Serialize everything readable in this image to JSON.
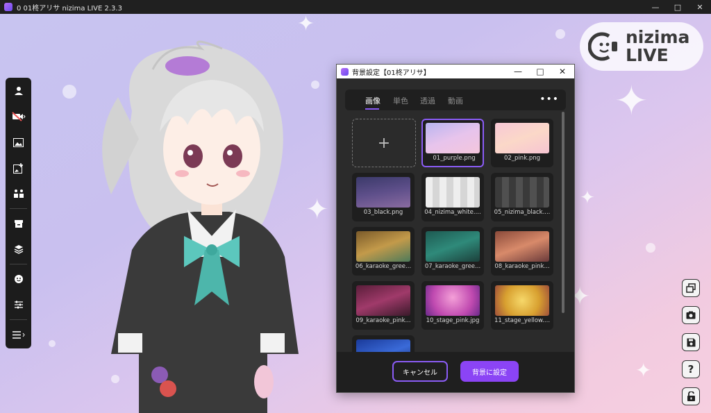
{
  "app": {
    "title": "0 01柊アリサ nizima LIVE 2.3.3"
  },
  "logo": {
    "line1": "nizima",
    "line2": "LIVE"
  },
  "left_toolbar": {
    "items": [
      "person-icon",
      "video-off-icon",
      "image-icon",
      "add-image-icon",
      "two-person-icon",
      "box-icon",
      "layers-icon",
      "smile-icon",
      "sliders-icon",
      "menu-icon"
    ]
  },
  "right_toolbar": {
    "items": [
      "windows-icon",
      "camera-icon",
      "save-icon",
      "help-icon",
      "unlock-icon"
    ]
  },
  "dialog": {
    "title": "背景設定【01柊アリサ】",
    "tabs": [
      "画像",
      "単色",
      "透過",
      "動画"
    ],
    "active_tab": "画像",
    "more": "•••",
    "add_symbol": "+",
    "files": [
      {
        "name": "01_purple.png",
        "selected": true
      },
      {
        "name": "02_pink.png"
      },
      {
        "name": "03_black.png"
      },
      {
        "name": "04_nizima_white...."
      },
      {
        "name": "05_nizima_black...."
      },
      {
        "name": "06_karaoke_gree..."
      },
      {
        "name": "07_karaoke_gree..."
      },
      {
        "name": "08_karaoke_pink..."
      },
      {
        "name": "09_karaoke_pink..."
      },
      {
        "name": "10_stage_pink.jpg"
      },
      {
        "name": "11_stage_yellow...."
      },
      {
        "name": ""
      }
    ],
    "cancel_label": "キャンセル",
    "confirm_label": "背景に設定"
  },
  "colors": {
    "accent": "#8b5cf6",
    "button": "#8b44f5"
  }
}
